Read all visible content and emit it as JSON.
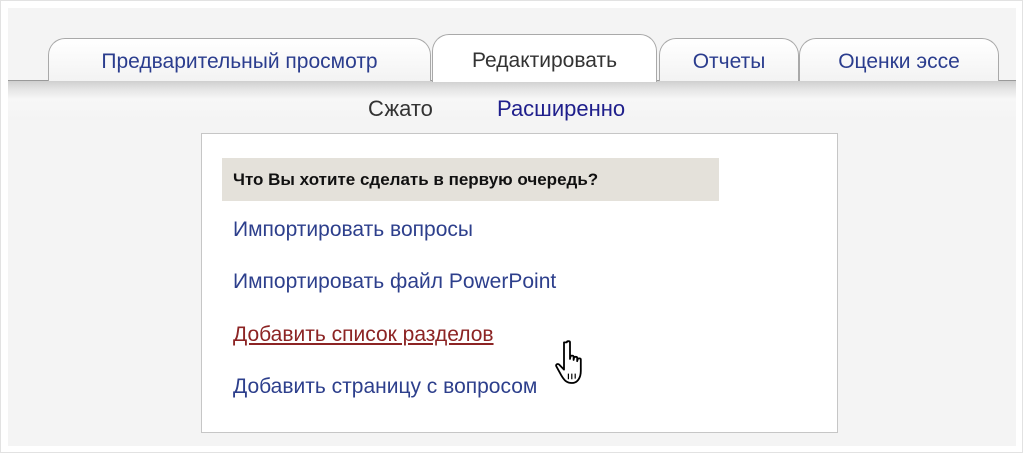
{
  "tabs": [
    {
      "label": "Предварительный просмотр",
      "active": false
    },
    {
      "label": "Редактировать",
      "active": true
    },
    {
      "label": "Отчеты",
      "active": false
    },
    {
      "label": "Оценки эссе",
      "active": false
    }
  ],
  "subtabs": {
    "collapsed": "Сжато",
    "expanded": "Расширенно"
  },
  "panel": {
    "question": "Что Вы хотите сделать в первую очередь?",
    "options": [
      "Импортировать вопросы",
      "Импортировать файл PowerPoint",
      "Добавить список разделов",
      "Добавить страницу с вопросом"
    ],
    "hovered_option": "Добавить список разделов"
  },
  "cursor": {
    "icon": "hand-pointer-icon"
  },
  "colors": {
    "link": "#2d3f8c",
    "link_hover": "#8c2424",
    "header_bg": "#e4e1da"
  }
}
